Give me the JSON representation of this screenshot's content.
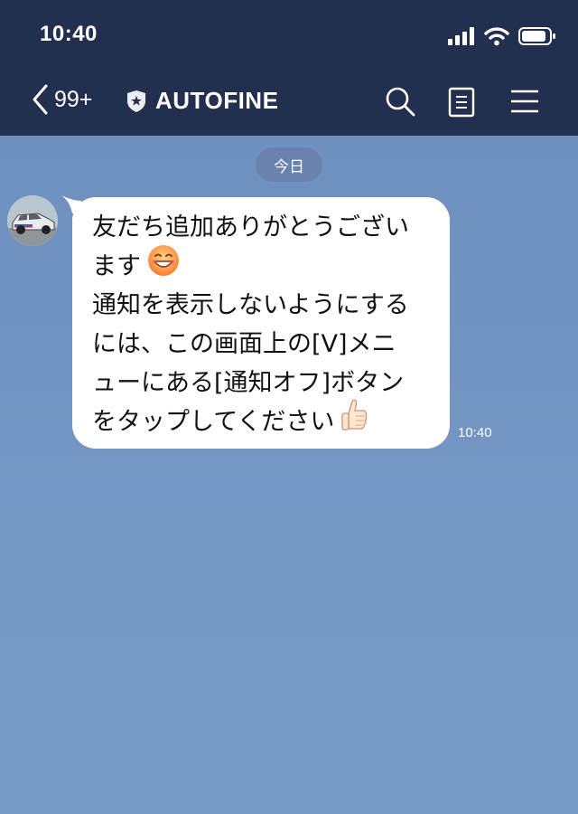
{
  "status_bar": {
    "time": "10:40"
  },
  "header": {
    "back_count": "99+",
    "title": "AUTOFINE"
  },
  "chat": {
    "date_label": "今日",
    "messages": [
      {
        "lines": [
          "友だち追加ありがとうござい",
          "ます",
          "通知を表示しないようにする",
          "には、この画面上の[V]メニ",
          "ューにある[通知オフ]ボタン",
          "をタップしてください"
        ],
        "emojis": [
          "grinning-face-emoji",
          "thumbs-up-emoji"
        ],
        "time": "10:40"
      }
    ]
  },
  "colors": {
    "header_bg": "#232f4e",
    "chat_bg": "#7494c1",
    "bubble_bg": "#ffffff"
  }
}
